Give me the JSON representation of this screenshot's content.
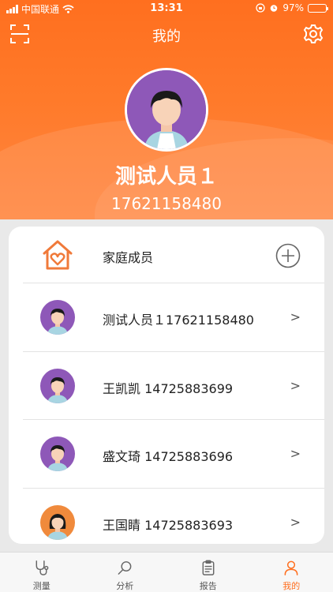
{
  "status_bar": {
    "carrier": "中国联通",
    "time": "13:31",
    "battery": "97%",
    "battery_level": 0.97
  },
  "nav": {
    "title": "我的",
    "scan_icon": "scan-icon",
    "settings_icon": "gear-icon"
  },
  "profile": {
    "name": "测试人员１",
    "phone": "17621158480",
    "avatar_color": "#8e58b8"
  },
  "family": {
    "header_label": "家庭成员",
    "header_icon": "family-home-icon",
    "add_icon": "plus-circle-icon",
    "members": [
      {
        "label": "测试人员１17621158480",
        "avatar": "male-avatar",
        "chevron": ">"
      },
      {
        "label": "王凯凯 14725883699",
        "avatar": "male-avatar",
        "chevron": ">"
      },
      {
        "label": "盛文琦 14725883696",
        "avatar": "male-avatar",
        "chevron": ">"
      },
      {
        "label": "王国睛 14725883693",
        "avatar": "female-avatar",
        "chevron": ">"
      }
    ]
  },
  "tabbar": {
    "tabs": [
      {
        "label": "测量",
        "icon": "stethoscope-icon",
        "active": false
      },
      {
        "label": "分析",
        "icon": "search-icon",
        "active": false
      },
      {
        "label": "报告",
        "icon": "clipboard-icon",
        "active": false
      },
      {
        "label": "我的",
        "icon": "person-icon",
        "active": true
      }
    ]
  },
  "colors": {
    "accent": "#ff6f1f",
    "male_avatar_bg": "#8e58b8",
    "female_avatar_bg": "#f08a3c"
  }
}
